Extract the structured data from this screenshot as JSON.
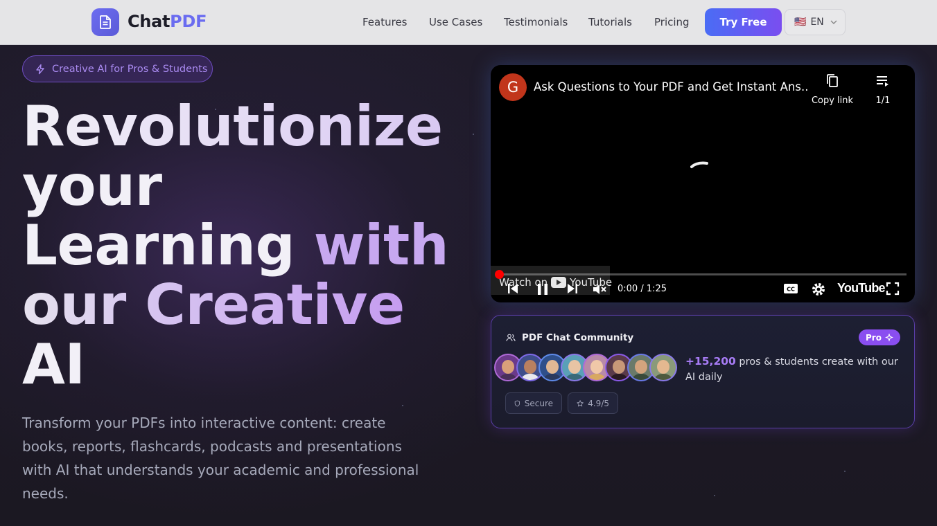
{
  "brand": {
    "name_part1": "Chat",
    "name_part2": "PDF"
  },
  "nav": {
    "links": [
      "Features",
      "Use Cases",
      "Testimonials",
      "Tutorials",
      "Pricing"
    ],
    "cta_label": "Try Free",
    "language": {
      "flag": "🇺🇸",
      "code": "EN"
    }
  },
  "hero": {
    "pill_text": "Creative AI for Pros & Students",
    "headline": {
      "l1": "Revolutionize",
      "l2": "your",
      "l3a": "Learning ",
      "l3b": "with",
      "l4": "our Creative",
      "l5": "AI"
    },
    "subtext": "Transform your PDFs into interactive content: create books, reports, flashcards, podcasts and presentations with AI that understands your academic and professional needs."
  },
  "video": {
    "channel_initial": "G",
    "title": "Ask Questions to Your PDF and Get Instant Ans...",
    "copy_link_label": "Copy link",
    "playlist_count": "1/1",
    "watch_on_label": "Watch on",
    "watch_on_brand": "YouTube",
    "time": "0:00 / 1:25",
    "youtube_wordmark": "YouTube",
    "progress": 0.0
  },
  "community": {
    "title": "PDF Chat Community",
    "badge": "Pro",
    "count": "+15,200",
    "description": " pros & students create with our AI daily",
    "chips": [
      {
        "icon": "shield-icon",
        "label": "Secure"
      },
      {
        "icon": "star-icon",
        "label": "4.9/5"
      }
    ],
    "avatar_count": 8
  },
  "colors": {
    "accent_blue": "#4a6cf5",
    "accent_purple": "#8a4ef0",
    "background": "#1a1820",
    "nav_bg": "#e5e5e7"
  }
}
